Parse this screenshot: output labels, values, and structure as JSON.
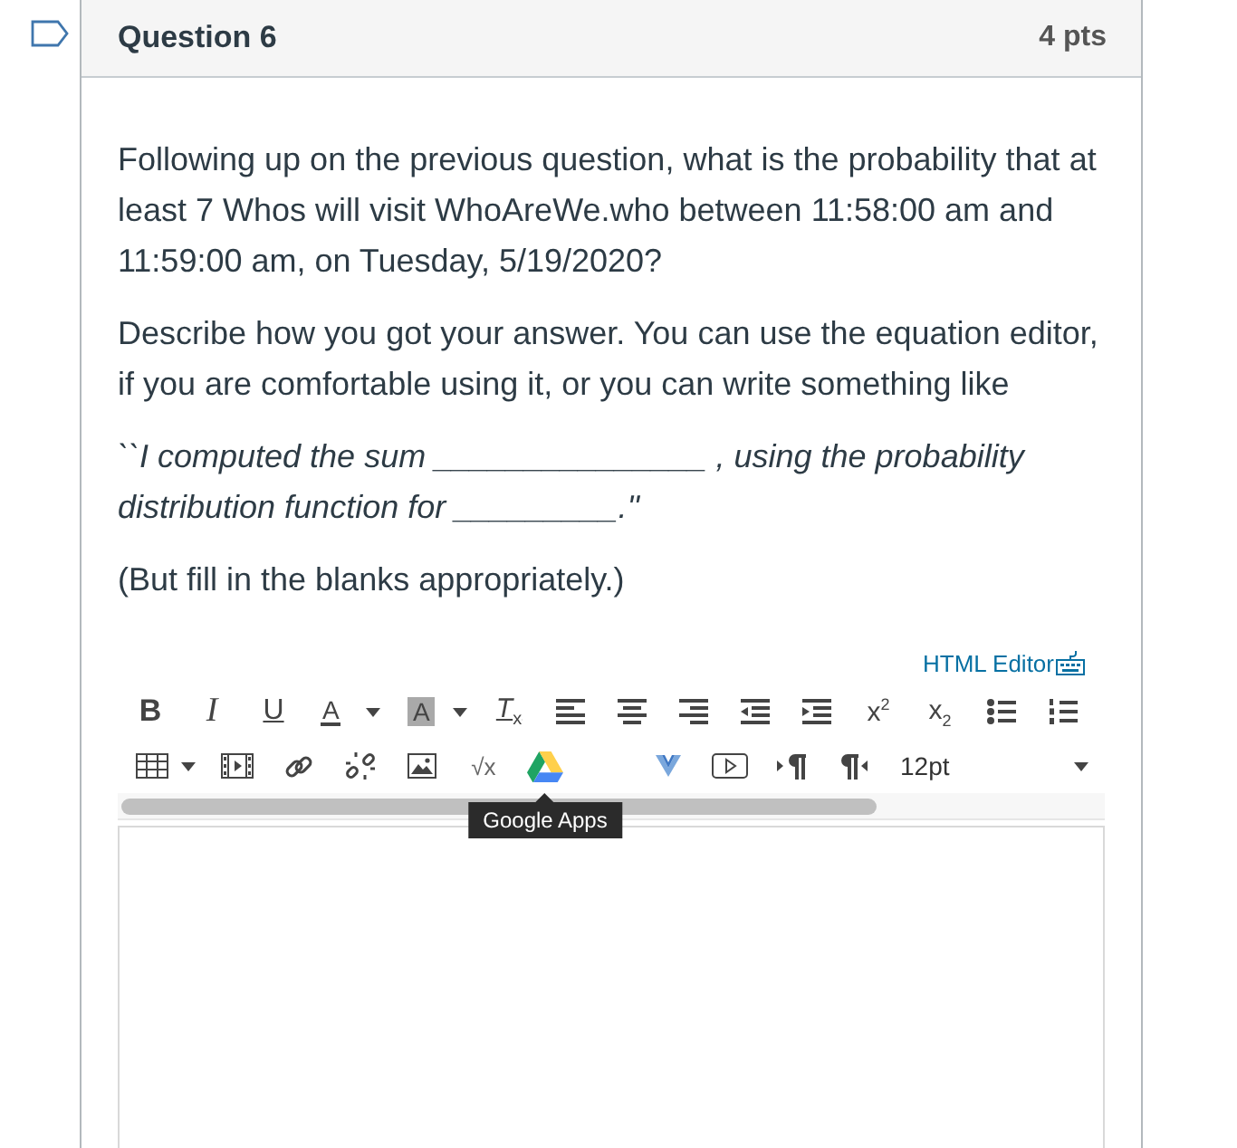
{
  "flag": {
    "flagged": false
  },
  "question": {
    "title": "Question 6",
    "points": "4 pts",
    "paragraphs": [
      {
        "kind": "plain",
        "text": "Following up on the previous question, what is the probability that at least 7 Whos will visit WhoAreWe.who between 11:58:00 am and 11:59:00 am, on Tuesday, 5/19/2020?"
      },
      {
        "kind": "plain",
        "text": "Describe how you got your answer. You can use the equation editor, if you are comfortable using it, or you can write something like"
      },
      {
        "kind": "quote",
        "text": "``I computed the sum _______________ , using the probability distribution function for _________.''"
      },
      {
        "kind": "plain",
        "text": "(But fill in the blanks appropriately.)"
      }
    ]
  },
  "editor": {
    "html_editor_link": "HTML Editor",
    "toolbar": [
      {
        "groups": [
          [
            {
              "kind": "bold",
              "label": "B",
              "menu": false
            },
            {
              "kind": "italic",
              "label": "I",
              "menu": false
            },
            {
              "kind": "underline",
              "label": "U",
              "menu": false
            },
            {
              "kind": "text-color",
              "label": "A",
              "menu": true
            },
            {
              "kind": "background-color",
              "label": "A",
              "menu": true
            },
            {
              "kind": "clear-formatting",
              "label": "T$_{x}$",
              "menu": false
            },
            {
              "kind": "align-left",
              "menu": false
            },
            {
              "kind": "align-center",
              "menu": false
            },
            {
              "kind": "align-right",
              "menu": false
            },
            {
              "kind": "outdent",
              "menu": false
            },
            {
              "kind": "indent",
              "menu": false
            },
            {
              "kind": "superscript",
              "label": "x$^{2}$",
              "menu": false
            },
            {
              "kind": "subscript",
              "label": "x$_{2}$",
              "menu": false
            },
            {
              "kind": "bullet-list",
              "menu": false
            },
            {
              "kind": "numbered-list",
              "menu": false
            }
          ]
        ]
      },
      {
        "groups": [
          [
            {
              "kind": "table",
              "menu": true
            },
            {
              "kind": "media",
              "menu": false
            },
            {
              "kind": "link",
              "menu": false
            },
            {
              "kind": "unlink",
              "menu": false
            },
            {
              "kind": "image",
              "menu": false
            },
            {
              "kind": "equation",
              "label": "√x",
              "menu": false
            },
            {
              "kind": "google-apps",
              "menu": false
            }
          ],
          [
            {
              "kind": "apps",
              "menu": false
            },
            {
              "kind": "video",
              "menu": false
            },
            {
              "kind": "ltr",
              "menu": false
            },
            {
              "kind": "rtl",
              "menu": false
            },
            {
              "kind": "font-size",
              "label": "12pt",
              "menu": true
            }
          ]
        ]
      }
    ],
    "tooltip": {
      "kind": "google-apps",
      "text": "Google Apps"
    }
  }
}
